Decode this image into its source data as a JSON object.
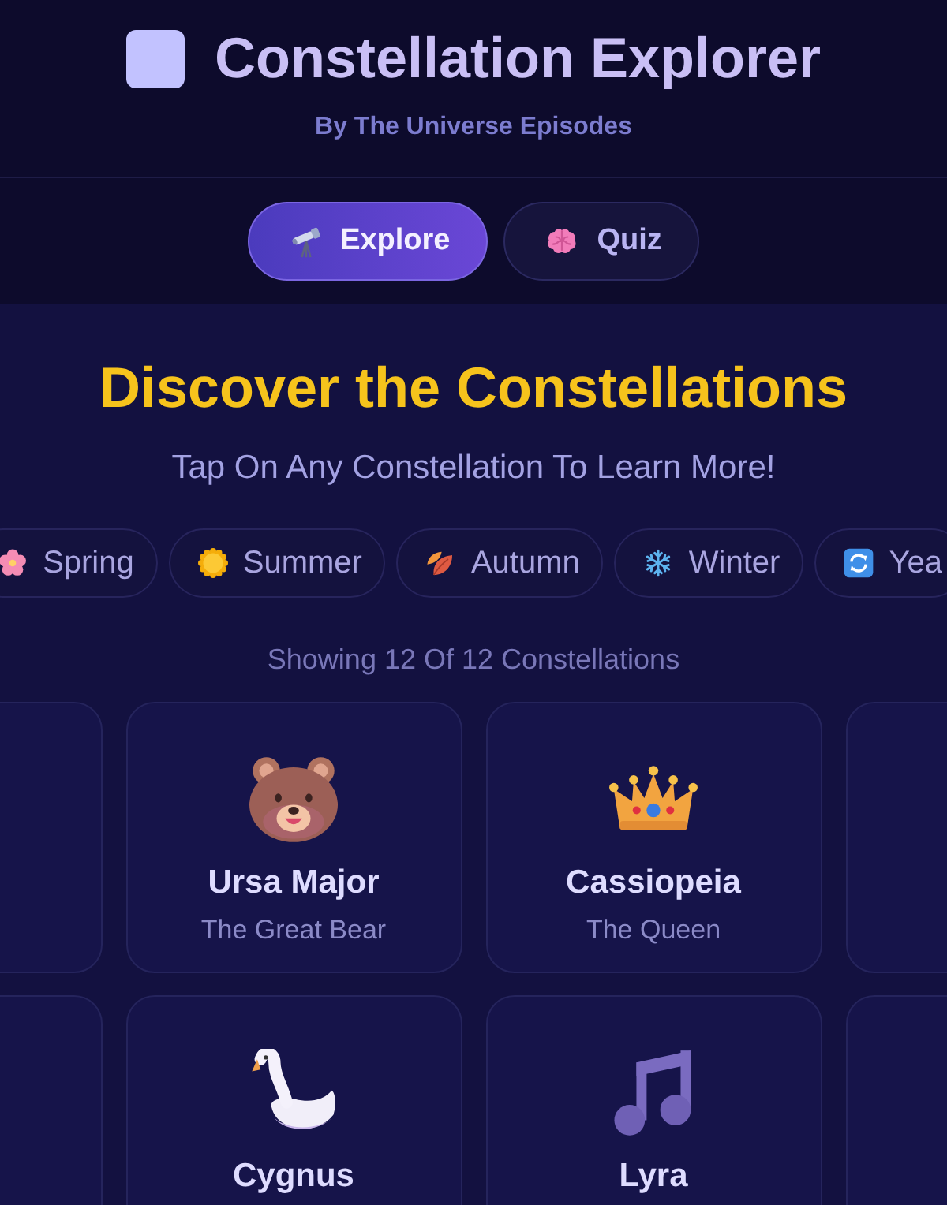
{
  "header": {
    "title": "Constellation Explorer",
    "subtitle": "By The Universe Episodes"
  },
  "tabs": [
    {
      "label": "Explore",
      "kind": "telescope",
      "selected": true
    },
    {
      "label": "Quiz",
      "kind": "brain",
      "selected": false
    }
  ],
  "explore": {
    "heading": "Discover the Constellations",
    "tagline": "Tap On Any Constellation To Learn More!",
    "season_filters": [
      {
        "label": "Spring",
        "kind": "flower",
        "selected": false
      },
      {
        "label": "Summer",
        "kind": "sun",
        "selected": false
      },
      {
        "label": "Autumn",
        "kind": "leaves",
        "selected": false
      },
      {
        "label": "Winter",
        "kind": "snowflake",
        "selected": false
      },
      {
        "label": "Yea",
        "kind": "cycle",
        "selected": false
      }
    ],
    "count": "Showing 12 Of 12 Constellations",
    "cards": [
      {
        "kind": "blank"
      },
      {
        "kind": "bear",
        "name": "Ursa Major",
        "nickname": "The Great Bear"
      },
      {
        "kind": "crown",
        "name": "Cassiopeia",
        "nickname": "The Queen"
      },
      {
        "kind": "blank"
      },
      {
        "kind": "blank"
      },
      {
        "kind": "swan",
        "name": "Cygnus"
      },
      {
        "kind": "note",
        "name": "Lyra"
      },
      {
        "kind": "blank"
      }
    ]
  }
}
